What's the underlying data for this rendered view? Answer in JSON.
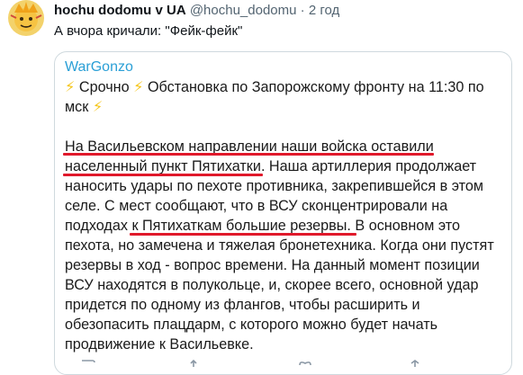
{
  "tweet": {
    "author_name": "hochu dodomu v UA",
    "author_handle": "@hochu_dodomu",
    "separator": "·",
    "time": "2 год",
    "text": "А вчора кричали: \"Фейк-фейк\""
  },
  "quote": {
    "author": "WarGonzo",
    "bolt": "⚡",
    "lines": [
      " Срочно ",
      " Обстановка по Запорожскому фронту на 11:30 по",
      "мск ",
      "На Васильевском направлении наши войска оставили",
      "населенный пункт Пятихатки",
      ". Наша артиллерия продолжает",
      "наносить удары по пехоте противника, закрепившейся в этом",
      "селе. С мест сообщают, что в ВСУ сконцентрировали на",
      "подходах ",
      " к Пятихаткам большие резервы",
      ". В основном это",
      "пехота, но замечена и тяжелая бронетехника. Когда они пустят",
      "резервы в ход - вопрос времени. На данный момент позиции",
      "ВСУ находятся в полукольце, и, скорее всего, основной удар",
      "придется по одному из флангов, чтобы расширить и",
      "обезопасить плацдарм, с которого можно будет начать",
      "продвижение к Васильевке."
    ]
  },
  "colors": {
    "link": "#2a9fd6",
    "underline": "#e0192b",
    "bolt": "#f5c518"
  },
  "icons": [
    "reply-icon",
    "retweet-icon",
    "like-icon",
    "share-icon"
  ]
}
